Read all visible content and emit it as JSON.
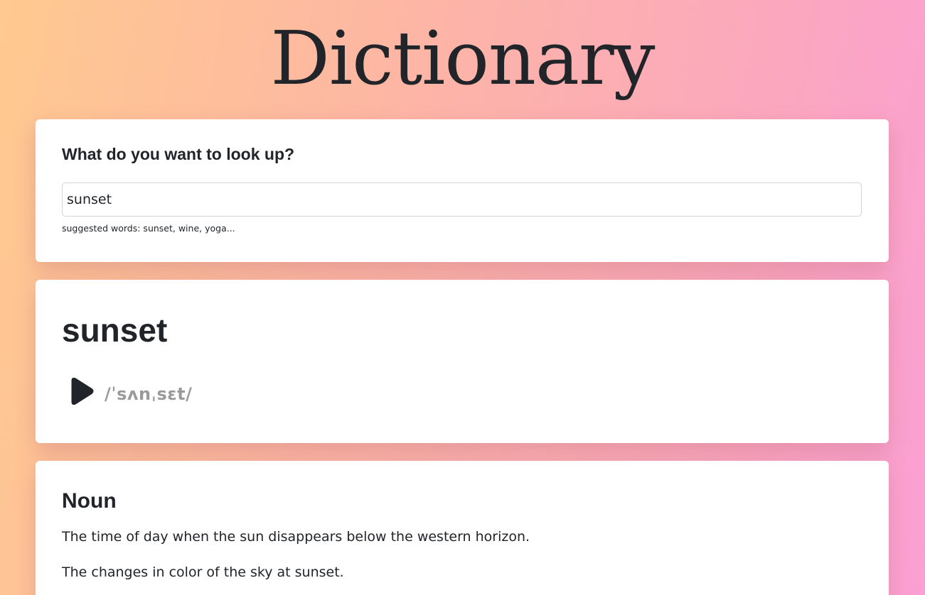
{
  "app": {
    "title": "Dictionary"
  },
  "search": {
    "heading": "What do you want to look up?",
    "value": "sunset",
    "hint": "suggested words: sunset, wine, yoga..."
  },
  "result": {
    "word": "sunset",
    "phonetic": "/ˈsʌnˌsɛt/",
    "play_icon": "play-icon"
  },
  "meanings": [
    {
      "part_of_speech": "Noun",
      "definitions": [
        "The time of day when the sun disappears below the western horizon.",
        "The changes in color of the sky at sunset."
      ]
    }
  ],
  "colors": {
    "text": "#212529",
    "phonetic": "#9a9a9a",
    "gradient_start": "#ffc990",
    "gradient_end": "#fb9fd4"
  }
}
